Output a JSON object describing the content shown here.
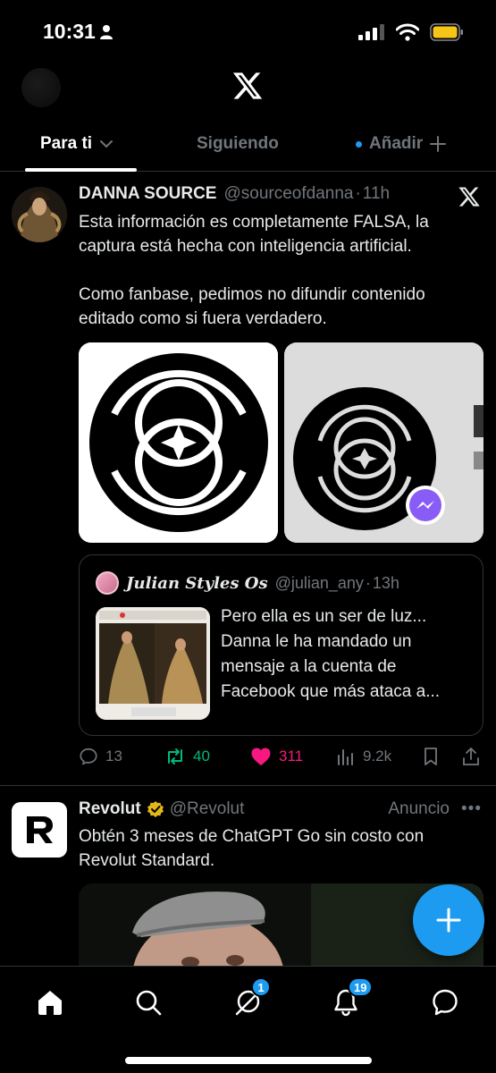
{
  "status_bar": {
    "time": "10:31"
  },
  "tabs": {
    "for_you": "Para ti",
    "following": "Siguiendo",
    "add": "Añadir"
  },
  "tweet": {
    "display_name": "DANNA SOURCE",
    "handle": "@sourceofdanna",
    "separator": "·",
    "time": "11h",
    "text": "Esta información es completamente FALSA, la captura está hecha con inteligencia artificial.\n\nComo fanbase, pedimos no difundir contenido editado como si fuera verdadero.",
    "quote": {
      "display_name": "Julian Styles Os",
      "handle": "@julian_any",
      "separator": "·",
      "time": "13h",
      "text": "Pero ella es un ser de luz... Danna le ha mandado un mensaje a la cuenta de Facebook que más ataca a..."
    },
    "actions": {
      "replies": "13",
      "retweets": "40",
      "likes": "311",
      "views": "9.2k"
    }
  },
  "ad": {
    "display_name": "Revolut",
    "handle": "@Revolut",
    "tag": "Anuncio",
    "text": "Obtén 3 meses de ChatGPT Go sin costo con Revolut Standard."
  },
  "bottom_nav": {
    "grok_badge": "1",
    "notifications_badge": "19"
  },
  "colors": {
    "background": "#000000",
    "accent": "#1d9bf0",
    "retweet": "#00ba7c",
    "like": "#f91880",
    "muted": "#71767b",
    "verified_gold": "#e2b719"
  }
}
